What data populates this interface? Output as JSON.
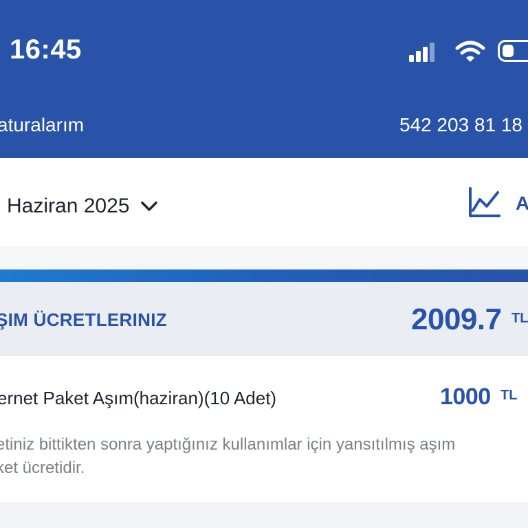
{
  "status_bar": {
    "time": "16:45",
    "signal_icon": "cellular-signal-icon",
    "wifi_icon": "wifi-icon",
    "battery_icon": "battery-icon"
  },
  "nav": {
    "title": "aturalarım",
    "phone_number": "542 203 81 18"
  },
  "period": {
    "selected_month": "Haziran 2025",
    "chevron_icon": "chevron-down-icon",
    "chart_icon": "line-chart-icon",
    "chart_button_label": "A"
  },
  "overage_card": {
    "title": "ŞIM ÜCRETLERINIZ",
    "total_amount": "2009.7",
    "total_unit": "TL",
    "items": [
      {
        "title": "ernet Paket Aşım(haziran)(10 Adet)",
        "amount": "1000",
        "unit": "TL",
        "description": "etiniz bittikten sonra yaptığınız kullanımlar için yansıtılmış aşım\nket ücretidir."
      }
    ]
  },
  "colors": {
    "brand_blue": "#2853a8",
    "header_bg": "#2853a8",
    "card_head_bg": "#eaedf2",
    "text_primary": "#1f2430",
    "text_muted": "#7b7f87"
  }
}
